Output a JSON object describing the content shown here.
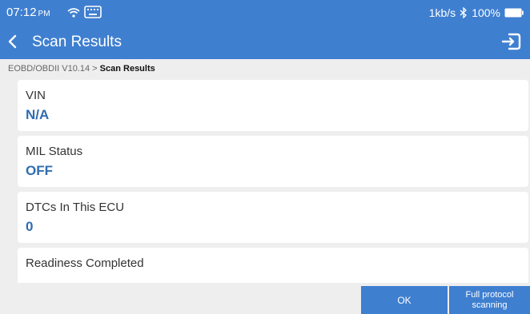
{
  "status_bar": {
    "time": "07:12",
    "ampm": "PM",
    "net_speed": "1kb/s",
    "battery": "100%",
    "icons": [
      "wifi-icon",
      "keyboard-icon",
      "bluetooth-icon",
      "battery-icon"
    ]
  },
  "app_bar": {
    "title": "Scan Results",
    "icons": [
      "back-arrow-icon",
      "exit-icon"
    ]
  },
  "breadcrumb": {
    "path": "EOBD/OBDII V10.14 >",
    "current": "Scan Results"
  },
  "items": [
    {
      "label": "VIN",
      "value": "N/A"
    },
    {
      "label": "MIL Status",
      "value": "OFF"
    },
    {
      "label": "DTCs In This ECU",
      "value": "0"
    },
    {
      "label": "Readiness Completed",
      "value": ""
    }
  ],
  "buttons": {
    "ok": "OK",
    "full_protocol": "Full protocol\nscanning"
  },
  "colors": {
    "accent": "#3f7fd0",
    "value_text": "#2f6db0",
    "background": "#eeeeee"
  }
}
